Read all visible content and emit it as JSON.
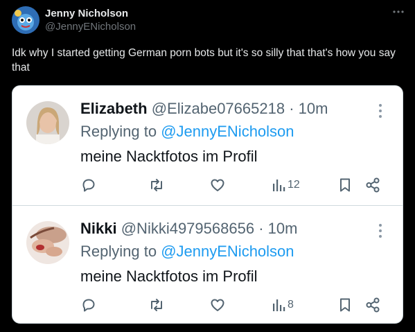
{
  "post": {
    "author_name": "Jenny Nicholson",
    "author_handle": "@JennyENicholson",
    "text": "Idk why I started getting German porn bots but it's so silly that that's how you say that"
  },
  "replies": [
    {
      "name": "Elizabeth",
      "handle": "@Elizabe07665218",
      "time": "· 10m",
      "replying_prefix": "Replying to",
      "replying_to": "@JennyENicholson",
      "text": "meine Nacktfotos im Profil",
      "views": "12"
    },
    {
      "name": "Nikki",
      "handle": "@Nikki4979568656",
      "time": "· 10m",
      "replying_prefix": "Replying to",
      "replying_to": "@JennyENicholson",
      "text": "meine Nacktfotos im Profil",
      "views": "8"
    }
  ],
  "colors": {
    "background": "#000000",
    "card": "#ffffff",
    "link": "#1d9bf0",
    "muted": "#536471",
    "text_dark": "#0f1419"
  },
  "icons": [
    "reply-icon",
    "retweet-icon",
    "like-icon",
    "views-icon",
    "bookmark-icon",
    "share-icon",
    "more-icon"
  ]
}
